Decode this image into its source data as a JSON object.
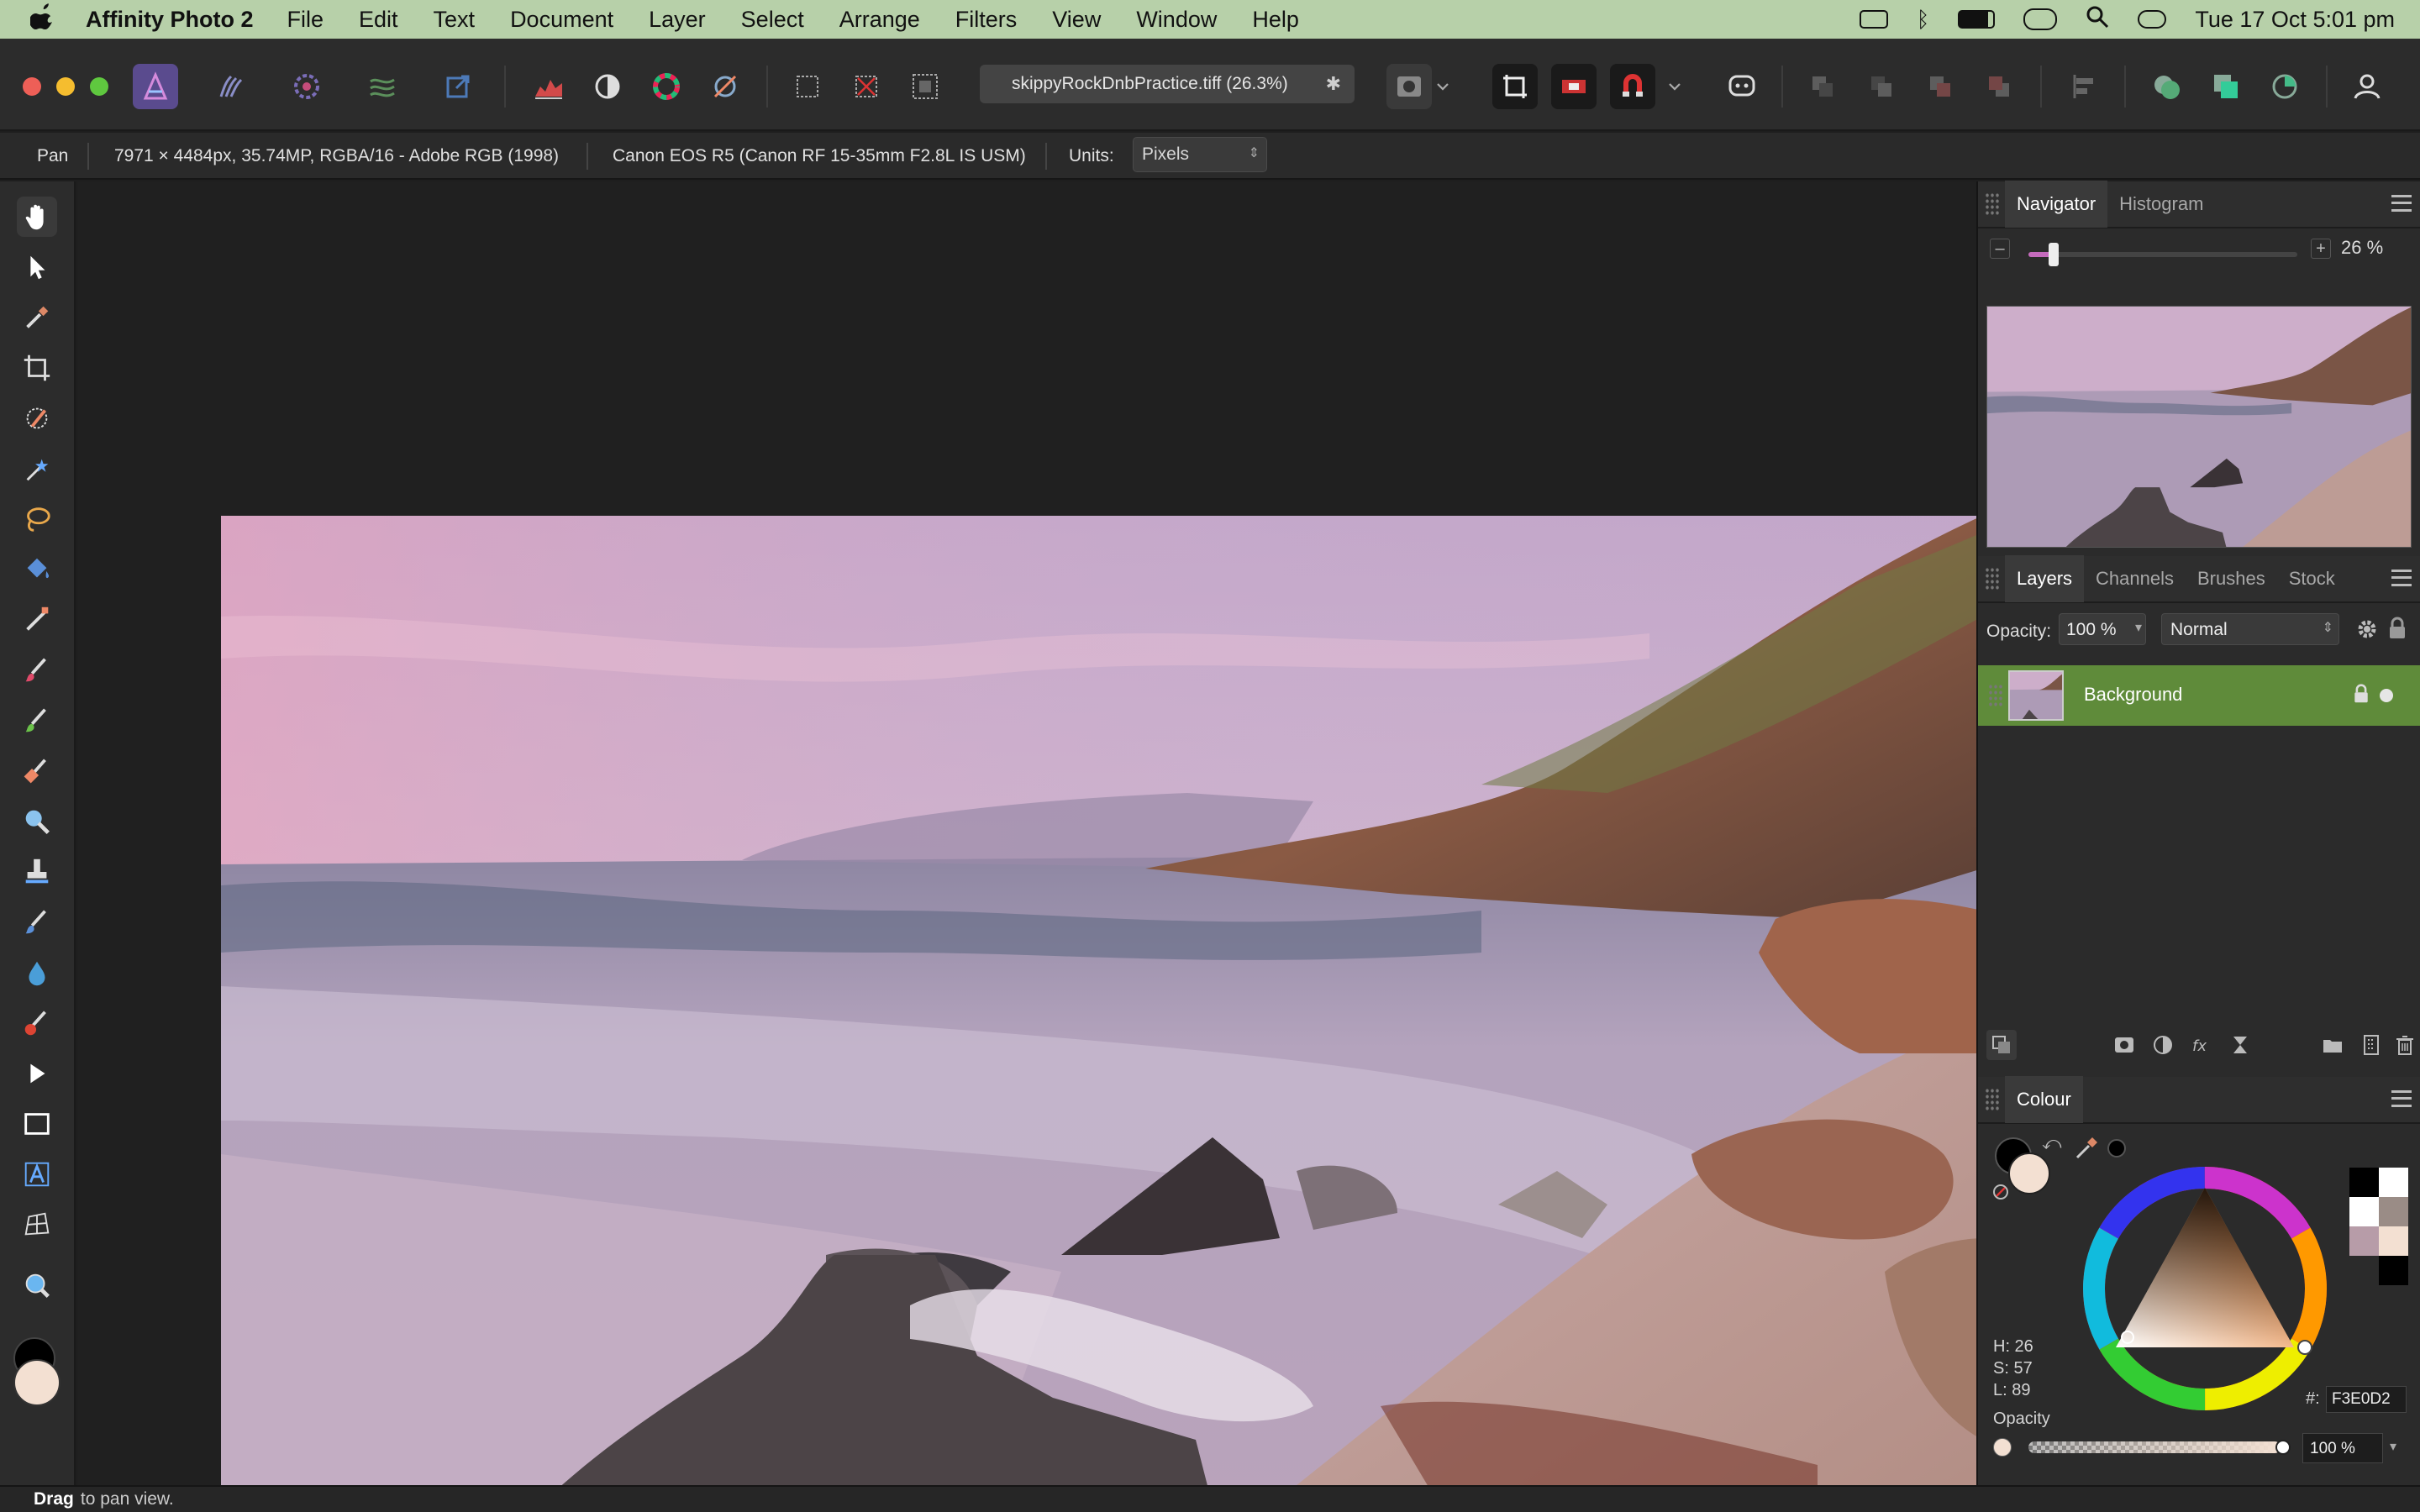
{
  "menubar": {
    "app_name": "Affinity Photo 2",
    "items": [
      "File",
      "Edit",
      "Text",
      "Document",
      "Layer",
      "Select",
      "Arrange",
      "Filters",
      "View",
      "Window",
      "Help"
    ],
    "clock": "Tue 17 Oct  5:01 pm"
  },
  "toolbar": {
    "document_tab": "skippyRockDnbPractice.tiff (26.3%)",
    "close_glyph": "✱"
  },
  "context_bar": {
    "tool": "Pan",
    "image_info": "7971 × 4484px, 35.74MP, RGBA/16 - Adobe RGB (1998)",
    "camera": "Canon EOS R5 (Canon RF 15-35mm F2.8L IS USM)",
    "units_label": "Units:",
    "units_value": "Pixels"
  },
  "navigator": {
    "tabs": [
      "Navigator",
      "Histogram"
    ],
    "zoom": "26 %",
    "zoom_fraction": 0.26
  },
  "layers": {
    "tabs": [
      "Layers",
      "Channels",
      "Brushes",
      "Stock"
    ],
    "opacity_label": "Opacity:",
    "opacity_value": "100 %",
    "blend_mode": "Normal",
    "items": [
      {
        "name": "Background"
      }
    ]
  },
  "colour": {
    "tab": "Colour",
    "h": "H: 26",
    "s": "S: 57",
    "l": "L: 89",
    "hex_label": "#:",
    "hex": "F3E0D2",
    "opacity_label": "Opacity",
    "opacity_value": "100 %",
    "fill_color": "#F3E0D2",
    "stroke_color": "#000000"
  },
  "status": {
    "bold": "Drag",
    "text": "to pan view."
  },
  "colors": {
    "menubar": "#b7d0a9",
    "selected_layer": "#5f8b3a",
    "accent": "#c56bbd"
  }
}
